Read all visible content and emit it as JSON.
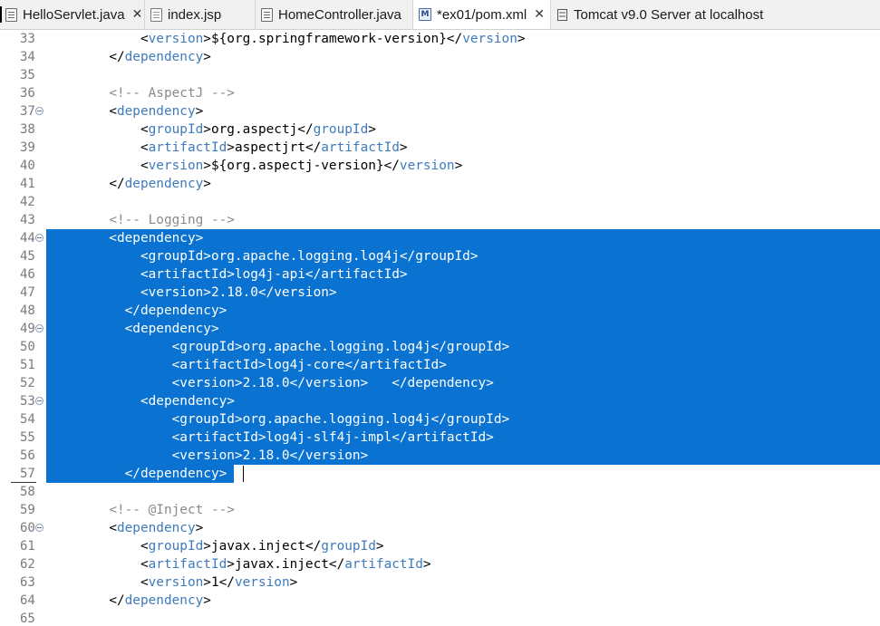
{
  "tabs": [
    {
      "label": "HelloServlet.java",
      "icon": "java-file-icon",
      "close": "✕"
    },
    {
      "label": "index.jsp",
      "icon": "jsp-file-icon"
    },
    {
      "label": "HomeController.java",
      "icon": "java-file-icon"
    },
    {
      "label": "*ex01/pom.xml",
      "icon": "maven-pom-icon",
      "icon_text": "M",
      "close": "✕"
    },
    {
      "label": "Tomcat v9.0 Server at localhost",
      "icon": "server-icon"
    }
  ],
  "colors": {
    "selection": "#0a72d1",
    "tag": "#3d7bbd",
    "comment": "#8a8a8a",
    "line_number": "#7a7a7a"
  },
  "lines": [
    {
      "num": "33",
      "segments": [
        {
          "t": "            "
        },
        {
          "c": "br",
          "t": "<"
        },
        {
          "c": "tag",
          "t": "version"
        },
        {
          "c": "br",
          "t": ">"
        },
        {
          "t": "${org.springframework-version}"
        },
        {
          "c": "br",
          "t": "</"
        },
        {
          "c": "tag",
          "t": "version"
        },
        {
          "c": "br",
          "t": ">"
        }
      ]
    },
    {
      "num": "34",
      "segments": [
        {
          "t": "        "
        },
        {
          "c": "br",
          "t": "</"
        },
        {
          "c": "tag",
          "t": "dependency"
        },
        {
          "c": "br",
          "t": ">"
        }
      ]
    },
    {
      "num": "35",
      "segments": []
    },
    {
      "num": "36",
      "segments": [
        {
          "t": "        "
        },
        {
          "c": "cmt",
          "t": "<!-- AspectJ -->"
        }
      ]
    },
    {
      "num": "37",
      "fold": true,
      "segments": [
        {
          "t": "        "
        },
        {
          "c": "br",
          "t": "<"
        },
        {
          "c": "tag",
          "t": "dependency"
        },
        {
          "c": "br",
          "t": ">"
        }
      ]
    },
    {
      "num": "38",
      "segments": [
        {
          "t": "            "
        },
        {
          "c": "br",
          "t": "<"
        },
        {
          "c": "tag",
          "t": "groupId"
        },
        {
          "c": "br",
          "t": ">"
        },
        {
          "t": "org.aspectj"
        },
        {
          "c": "br",
          "t": "</"
        },
        {
          "c": "tag",
          "t": "groupId"
        },
        {
          "c": "br",
          "t": ">"
        }
      ]
    },
    {
      "num": "39",
      "segments": [
        {
          "t": "            "
        },
        {
          "c": "br",
          "t": "<"
        },
        {
          "c": "tag",
          "t": "artifactId"
        },
        {
          "c": "br",
          "t": ">"
        },
        {
          "t": "aspectjrt"
        },
        {
          "c": "br",
          "t": "</"
        },
        {
          "c": "tag",
          "t": "artifactId"
        },
        {
          "c": "br",
          "t": ">"
        }
      ]
    },
    {
      "num": "40",
      "segments": [
        {
          "t": "            "
        },
        {
          "c": "br",
          "t": "<"
        },
        {
          "c": "tag",
          "t": "version"
        },
        {
          "c": "br",
          "t": ">"
        },
        {
          "t": "${org.aspectj-version}"
        },
        {
          "c": "br",
          "t": "</"
        },
        {
          "c": "tag",
          "t": "version"
        },
        {
          "c": "br",
          "t": ">"
        }
      ]
    },
    {
      "num": "41",
      "segments": [
        {
          "t": "        "
        },
        {
          "c": "br",
          "t": "</"
        },
        {
          "c": "tag",
          "t": "dependency"
        },
        {
          "c": "br",
          "t": ">"
        }
      ]
    },
    {
      "num": "42",
      "segments": []
    },
    {
      "num": "43",
      "segments": [
        {
          "t": "        "
        },
        {
          "c": "cmt",
          "t": "<!-- Logging -->"
        }
      ]
    },
    {
      "num": "44",
      "fold": true,
      "selected": "full",
      "segments": [
        {
          "t": "        <dependency>"
        }
      ]
    },
    {
      "num": "45",
      "selected": "full",
      "segments": [
        {
          "t": "            <groupId>org.apache.logging.log4j</groupId>"
        }
      ]
    },
    {
      "num": "46",
      "selected": "full",
      "segments": [
        {
          "t": "            <artifactId>log4j-api</artifactId>"
        }
      ]
    },
    {
      "num": "47",
      "selected": "full",
      "segments": [
        {
          "t": "            <version>2.18.0</version>"
        }
      ]
    },
    {
      "num": "48",
      "selected": "full",
      "segments": [
        {
          "t": "          </dependency>"
        }
      ]
    },
    {
      "num": "49",
      "fold": true,
      "selected": "full",
      "segments": [
        {
          "t": "          <dependency>"
        }
      ]
    },
    {
      "num": "50",
      "selected": "full",
      "segments": [
        {
          "t": "                <groupId>org.apache.logging.log4j</groupId>"
        }
      ]
    },
    {
      "num": "51",
      "selected": "full",
      "segments": [
        {
          "t": "                <artifactId>log4j-core</artifactId>"
        }
      ]
    },
    {
      "num": "52",
      "selected": "full",
      "segments": [
        {
          "t": "                <version>2.18.0</version>   </dependency>"
        }
      ]
    },
    {
      "num": "53",
      "fold": true,
      "selected": "full",
      "segments": [
        {
          "t": "            <dependency>"
        }
      ]
    },
    {
      "num": "54",
      "selected": "full",
      "segments": [
        {
          "t": "                <groupId>org.apache.logging.log4j</groupId>"
        }
      ]
    },
    {
      "num": "55",
      "selected": "full",
      "segments": [
        {
          "t": "                <artifactId>log4j-slf4j-impl</artifactId>"
        }
      ]
    },
    {
      "num": "56",
      "selected": "full",
      "segments": [
        {
          "t": "                <version>2.18.0</version>"
        }
      ]
    },
    {
      "num": "57",
      "selected": "partial",
      "caret": true,
      "segments": [
        {
          "t": "          </dependency>"
        }
      ]
    },
    {
      "num": "58",
      "segments": []
    },
    {
      "num": "59",
      "segments": [
        {
          "t": "        "
        },
        {
          "c": "cmt",
          "t": "<!-- @Inject -->"
        }
      ]
    },
    {
      "num": "60",
      "fold": true,
      "segments": [
        {
          "t": "        "
        },
        {
          "c": "br",
          "t": "<"
        },
        {
          "c": "tag",
          "t": "dependency"
        },
        {
          "c": "br",
          "t": ">"
        }
      ]
    },
    {
      "num": "61",
      "segments": [
        {
          "t": "            "
        },
        {
          "c": "br",
          "t": "<"
        },
        {
          "c": "tag",
          "t": "groupId"
        },
        {
          "c": "br",
          "t": ">"
        },
        {
          "t": "javax.inject"
        },
        {
          "c": "br",
          "t": "</"
        },
        {
          "c": "tag",
          "t": "groupId"
        },
        {
          "c": "br",
          "t": ">"
        }
      ]
    },
    {
      "num": "62",
      "segments": [
        {
          "t": "            "
        },
        {
          "c": "br",
          "t": "<"
        },
        {
          "c": "tag",
          "t": "artifactId"
        },
        {
          "c": "br",
          "t": ">"
        },
        {
          "t": "javax.inject"
        },
        {
          "c": "br",
          "t": "</"
        },
        {
          "c": "tag",
          "t": "artifactId"
        },
        {
          "c": "br",
          "t": ">"
        }
      ]
    },
    {
      "num": "63",
      "segments": [
        {
          "t": "            "
        },
        {
          "c": "br",
          "t": "<"
        },
        {
          "c": "tag",
          "t": "version"
        },
        {
          "c": "br",
          "t": ">"
        },
        {
          "t": "1"
        },
        {
          "c": "br",
          "t": "</"
        },
        {
          "c": "tag",
          "t": "version"
        },
        {
          "c": "br",
          "t": ">"
        }
      ]
    },
    {
      "num": "64",
      "segments": [
        {
          "t": "        "
        },
        {
          "c": "br",
          "t": "</"
        },
        {
          "c": "tag",
          "t": "dependency"
        },
        {
          "c": "br",
          "t": ">"
        }
      ]
    },
    {
      "num": "65",
      "segments": []
    }
  ]
}
